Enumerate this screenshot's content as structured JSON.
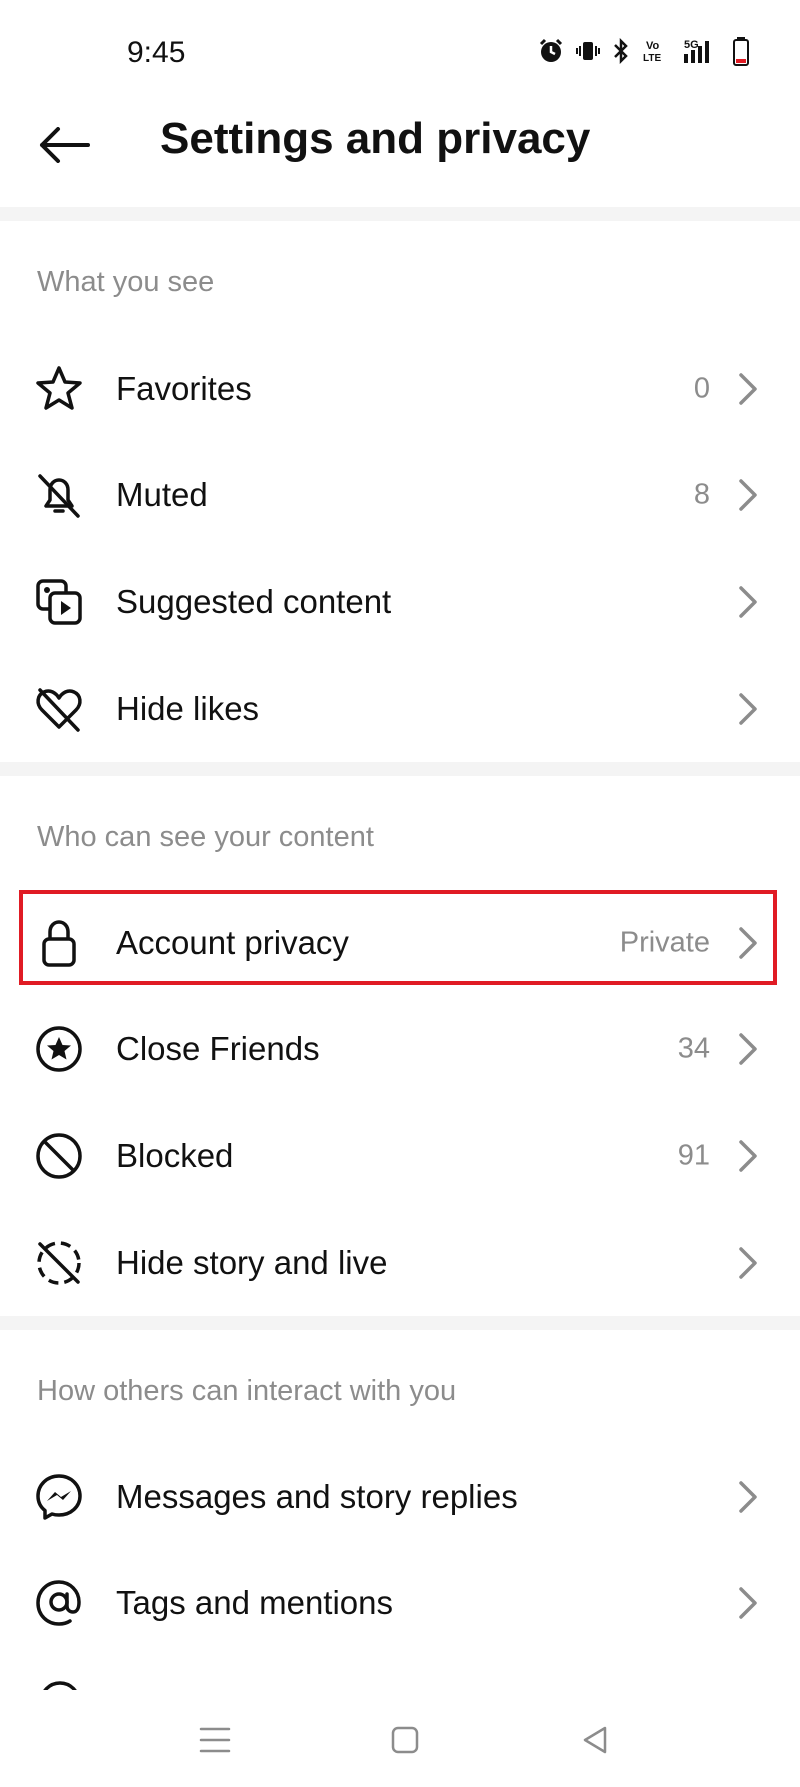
{
  "status_bar": {
    "time": "9:45",
    "icons": [
      "alarm-icon",
      "vibrate-icon",
      "bluetooth-icon",
      "volte-icon",
      "5g-signal-icon",
      "battery-icon"
    ],
    "volte_text": "Vo\nLTE",
    "network_text": "5G"
  },
  "header": {
    "title": "Settings and privacy",
    "back_icon": "arrow-left-icon"
  },
  "sections": [
    {
      "label": "What you see",
      "items": [
        {
          "icon": "star-icon",
          "label": "Favorites",
          "value": "0"
        },
        {
          "icon": "bell-off-icon",
          "label": "Muted",
          "value": "8"
        },
        {
          "icon": "media-icon",
          "label": "Suggested content",
          "value": ""
        },
        {
          "icon": "heart-off-icon",
          "label": "Hide likes",
          "value": ""
        }
      ]
    },
    {
      "label": "Who can see your content",
      "items": [
        {
          "icon": "lock-icon",
          "label": "Account privacy",
          "value": "Private",
          "highlighted": true
        },
        {
          "icon": "close-friends-star-icon",
          "label": "Close Friends",
          "value": "34"
        },
        {
          "icon": "blocked-icon",
          "label": "Blocked",
          "value": "91"
        },
        {
          "icon": "story-off-icon",
          "label": "Hide story and live",
          "value": ""
        }
      ]
    },
    {
      "label": "How others can interact with you",
      "items": [
        {
          "icon": "messenger-icon",
          "label": "Messages and story replies",
          "value": ""
        },
        {
          "icon": "at-sign-icon",
          "label": "Tags and mentions",
          "value": ""
        }
      ]
    }
  ],
  "colors": {
    "highlight_border": "#e01b24",
    "secondary_text": "#8c8c8c",
    "divider": "#f4f4f4"
  },
  "nav_bar": {
    "icons": [
      "menu-icon",
      "home-square-icon",
      "back-triangle-icon"
    ]
  }
}
